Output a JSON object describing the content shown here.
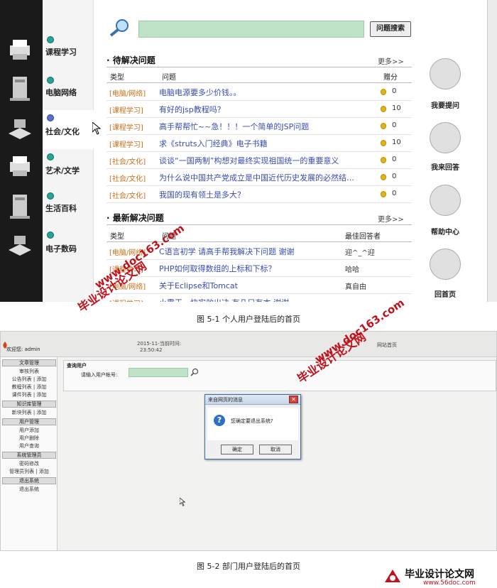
{
  "figure1": {
    "categories": [
      {
        "label": "课程学习"
      },
      {
        "label": "电脑网络"
      },
      {
        "label": "社会/文化"
      },
      {
        "label": "艺术/文学"
      },
      {
        "label": "生活百科"
      },
      {
        "label": "电子数码"
      }
    ],
    "search_button": "问题搜索",
    "pending": {
      "title": "· 待解决问题",
      "more": "更多>>",
      "col_type": "类型",
      "col_question": "问题",
      "col_score": "赠分",
      "rows": [
        {
          "type": "[电脑/网络]",
          "question": "电脑电源要多少价钱。。",
          "score": "0"
        },
        {
          "type": "[课程学习]",
          "question": "有好的jsp教程吗？",
          "score": "10"
        },
        {
          "type": "[课程学习]",
          "question": "高手帮帮忙~~急！！！一个简单的JSP问题",
          "score": "0"
        },
        {
          "type": "[课程学习]",
          "question": "求《struts入门经典》电子书籍",
          "score": "10"
        },
        {
          "type": "[社会/文化]",
          "question": "谈谈“一国两制”构想对最终实现祖国统一的重要意义",
          "score": "0"
        },
        {
          "type": "[社会/文化]",
          "question": "为什么说中国共产党成立是中国近代历史发展的必然结…",
          "score": "0"
        },
        {
          "type": "[社会/文化]",
          "question": "我国的现有领土是多大？",
          "score": "0"
        }
      ]
    },
    "solved": {
      "title": "· 最新解决问题",
      "more": "更多>>",
      "col_type": "类型",
      "col_question": "问题",
      "col_answerer": "最佳回答者",
      "rows": [
        {
          "type": "[电脑/网络]",
          "question": "C语言初学 请高手帮我解决下问题 谢谢",
          "answerer": "迎^_^迎"
        },
        {
          "type": "[课程学习]",
          "question": "PHP如何取得数组的上标和下标？",
          "answerer": "哈哈"
        },
        {
          "type": "[电脑/网络]",
          "question": "关于Eclipse和Tomcat",
          "answerer": "真自由"
        },
        {
          "type": "[课程学习]",
          "question": "小霸王…快实效出决 有几只有本 谢谢",
          "answerer": "…"
        }
      ]
    },
    "right_buttons": [
      {
        "label": "我要提问",
        "icon": "question-icon"
      },
      {
        "label": "我来回答",
        "icon": "answer-icon"
      },
      {
        "label": "帮助中心",
        "icon": "help-icon"
      },
      {
        "label": "回首页",
        "icon": "home-icon"
      }
    ]
  },
  "caption1": "图 5-1   个人用户登陆后的首页",
  "figure2": {
    "welcome": "欢迎您: admin",
    "datetime_line1": "2015-11-当前时间:",
    "datetime_line2": "23:50:42",
    "top_link": "网站首页",
    "menu": [
      {
        "group": "文章管理",
        "items": [
          "审核列表",
          "公告列表 | 添加",
          "教程列表 | 添加",
          "课件列表 | 添加"
        ]
      },
      {
        "group": "知识库管理",
        "items": [
          "新块列表 | 添加"
        ]
      },
      {
        "group": "用户管理",
        "items": [
          "用户添加",
          "用户删除",
          "用户查询"
        ]
      },
      {
        "group": "系统管理员",
        "items": [
          "密码修改",
          "管理员列表 | 添加"
        ]
      },
      {
        "group": "退出系统",
        "items": [
          "退出系统"
        ]
      }
    ],
    "panel_title": "查询用户",
    "input_label": "请输入用户帐号:",
    "dialog": {
      "title": "来自网页的消息",
      "message": "您确定要退出系统?",
      "ok": "确定",
      "cancel": "取消"
    }
  },
  "caption2": "图 5-2   部门用户登陆后的首页",
  "watermarks": {
    "site_cn": "毕业设计论文网",
    "site_url": "www.doc163.com",
    "brand_name": "毕业设计论文网",
    "brand_url": "www.56doc.com"
  },
  "colors": {
    "accent_green": "#bfe3c7",
    "link_blue": "#3a4bb0",
    "type_orange": "#c8701a",
    "watermark_red": "#c0121b"
  }
}
